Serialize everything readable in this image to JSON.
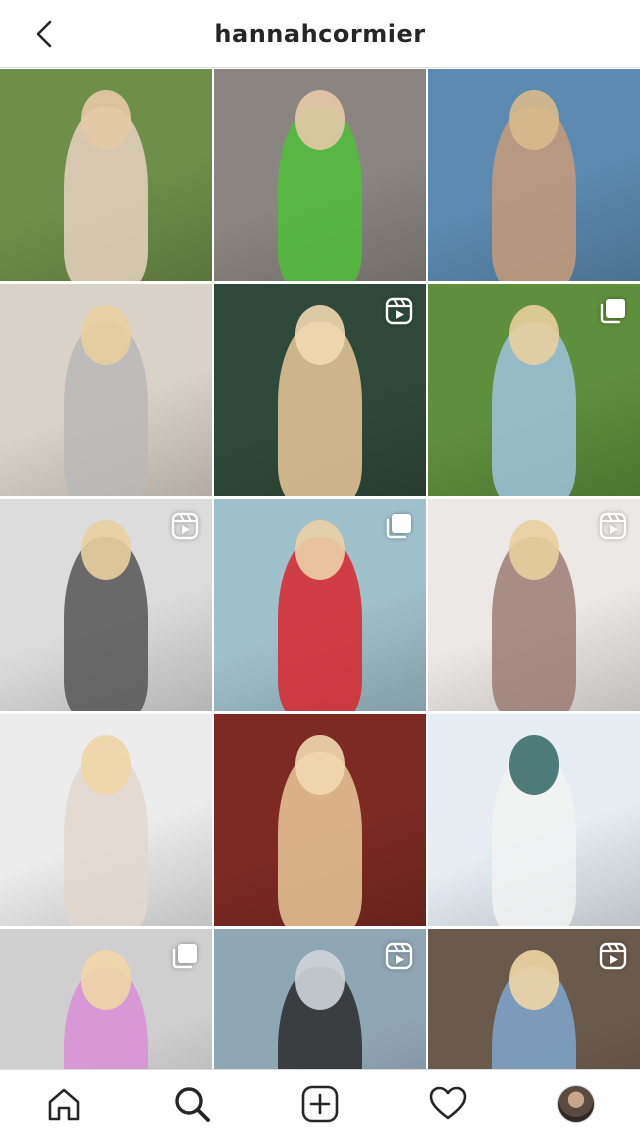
{
  "header": {
    "title": "hannahcormier",
    "back_icon": "chevron-left-icon"
  },
  "grid": {
    "tiles": [
      {
        "bg": "#6e8f4a",
        "fig": "#e8d2c0",
        "head": "#e6c9a6",
        "badge": ""
      },
      {
        "bg": "#8a8580",
        "fig": "#4fbf3a",
        "head": "#e6c9a6",
        "badge": ""
      },
      {
        "bg": "#5c8ab0",
        "fig": "#c89a78",
        "head": "#d9b98c",
        "badge": ""
      },
      {
        "bg": "#d9d2c8",
        "fig": "#b9b9b9",
        "head": "#e8cf9e",
        "badge": ""
      },
      {
        "bg": "#2f4a3a",
        "fig": "#e9c89a",
        "head": "#f1d8b0",
        "badge": "reel"
      },
      {
        "bg": "#5e8f3c",
        "fig": "#9fc3dd",
        "head": "#e8cf9e",
        "badge": "carousel"
      },
      {
        "bg": "#dcdcdc",
        "fig": "#555555",
        "head": "#e8cf9e",
        "badge": "reel"
      },
      {
        "bg": "#9fc1cc",
        "fig": "#d8262e",
        "head": "#ead2a6",
        "badge": "carousel"
      },
      {
        "bg": "#ece8e6",
        "fig": "#9b7d74",
        "head": "#e8cf9e",
        "badge": "reel"
      },
      {
        "bg": "#ececec",
        "fig": "#e0d7cf",
        "head": "#efd6a6",
        "badge": ""
      },
      {
        "bg": "#7d2a22",
        "fig": "#e9c89a",
        "head": "#f1d8b0",
        "badge": ""
      },
      {
        "bg": "#e7edf2",
        "fig": "#f2f2f2",
        "head": "#3c6e6a",
        "badge": ""
      },
      {
        "bg": "#cfcfcf",
        "fig": "#d98ed6",
        "head": "#efd6a6",
        "badge": "carousel"
      },
      {
        "bg": "#8fa6b3",
        "fig": "#2c2c2c",
        "head": "#cfd4d8",
        "badge": "reel"
      },
      {
        "bg": "#6a5a4c",
        "fig": "#7fa7cf",
        "head": "#efd6a6",
        "badge": "reel"
      }
    ]
  },
  "nav": {
    "items": [
      {
        "icon": "home-icon"
      },
      {
        "icon": "search-icon"
      },
      {
        "icon": "add-post-icon"
      },
      {
        "icon": "heart-icon"
      },
      {
        "icon": "profile-avatar"
      }
    ]
  },
  "colors": {
    "text": "#262626",
    "border": "#dbdbdb",
    "background": "#ffffff"
  }
}
